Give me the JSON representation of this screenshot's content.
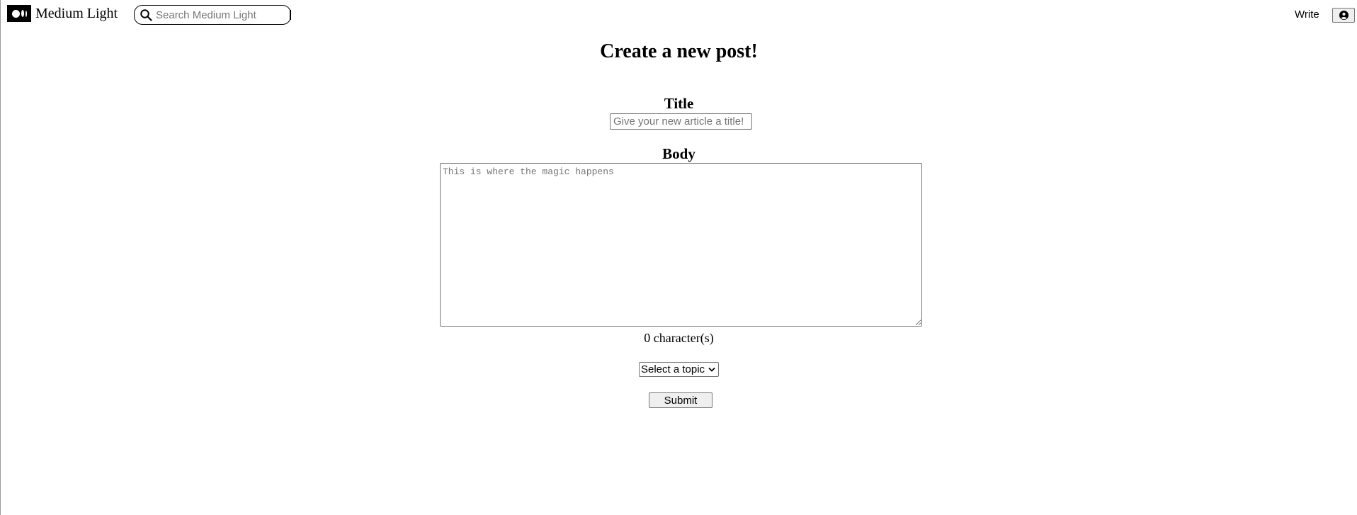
{
  "header": {
    "brand_name": "Medium Light",
    "search": {
      "placeholder": "Search Medium Light",
      "value": ""
    },
    "write_label": "Write",
    "icons": {
      "logo": "medium-logo-icon",
      "search": "search-icon",
      "profile": "user-circle-icon"
    }
  },
  "form": {
    "page_title": "Create a new post!",
    "title_label": "Title",
    "title_placeholder": "Give your new article a title!",
    "title_value": "",
    "body_label": "Body",
    "body_placeholder": "This is where the magic happens",
    "body_value": "",
    "char_count": "0 character(s)",
    "topic_selected": "Select a topic",
    "submit_label": "Submit"
  },
  "colors": {
    "background": "#ffffff",
    "text": "#000000",
    "border": "#767676",
    "button_bg": "#efefef",
    "placeholder": "#757575"
  }
}
